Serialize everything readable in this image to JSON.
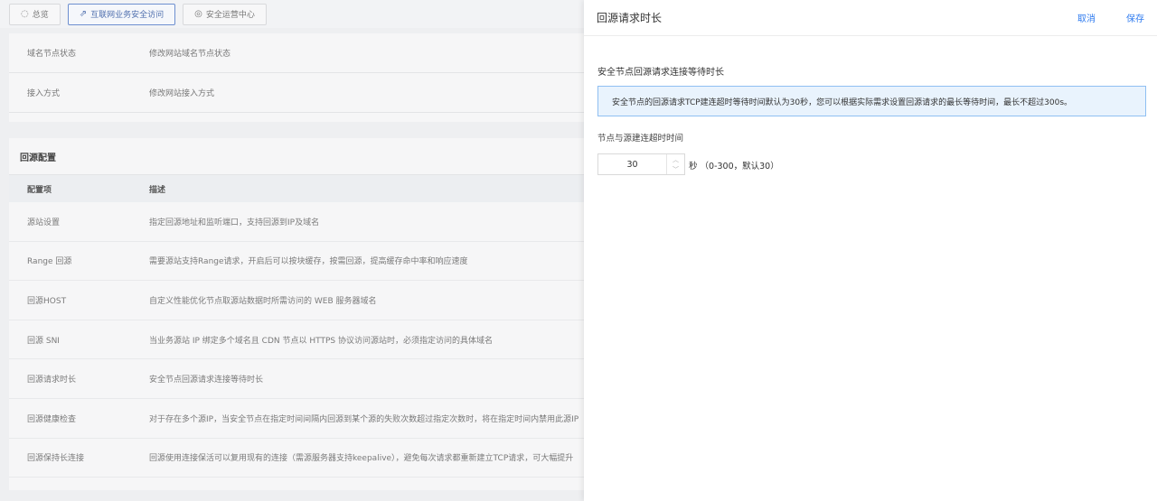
{
  "topbar": {
    "tabs": [
      {
        "label": "总览",
        "active": false
      },
      {
        "label": "互联网业务安全访问",
        "active": true
      },
      {
        "label": "安全运营中心",
        "active": false
      }
    ]
  },
  "basic_rows": [
    {
      "name": "域名节点状态",
      "desc": "修改网站域名节点状态"
    },
    {
      "name": "接入方式",
      "desc": "修改网站接入方式"
    }
  ],
  "origin_config": {
    "title": "回源配置",
    "columns": [
      "配置项",
      "描述"
    ],
    "rows": [
      {
        "name": "源站设置",
        "desc": "指定回源地址和监听端口，支持回源到IP及域名"
      },
      {
        "name": "Range 回源",
        "desc": "需要源站支持Range请求，开启后可以按块缓存，按需回源，提高缓存命中率和响应速度"
      },
      {
        "name": "回源HOST",
        "desc": "自定义性能优化节点取源站数据时所需访问的 WEB 服务器域名"
      },
      {
        "name": "回源 SNI",
        "desc": "当业务源站 IP 绑定多个域名且 CDN 节点以 HTTPS 协议访问源站时，必须指定访问的具体域名"
      },
      {
        "name": "回源请求时长",
        "desc": "安全节点回源请求连接等待时长"
      },
      {
        "name": "回源健康检查",
        "desc": "对于存在多个源IP，当安全节点在指定时间间隔内回源到某个源的失败次数超过指定次数时，将在指定时间内禁用此源IP"
      },
      {
        "name": "回源保持长连接",
        "desc": "回源使用连接保活可以复用现有的连接（需源服务器支持keepalive），避免每次请求都重新建立TCP请求，可大幅提升"
      }
    ]
  },
  "drawer": {
    "title": "回源请求时长",
    "cancel_label": "取消",
    "save_label": "保存",
    "subtitle": "安全节点回源请求连接等待时长",
    "notice": "安全节点的回源请求TCP建连超时等待时间默认为30秒，您可以根据实际需求设置回源请求的最长等待时间，最长不超过300s。",
    "field_label": "节点与源建连超时时间",
    "field_value": "30",
    "field_hint": "秒 （0-300，默认30）"
  },
  "colors": {
    "accent": "#2f7bef",
    "notice_bg": "#e9f3fd",
    "notice_border": "#8fbff2"
  }
}
